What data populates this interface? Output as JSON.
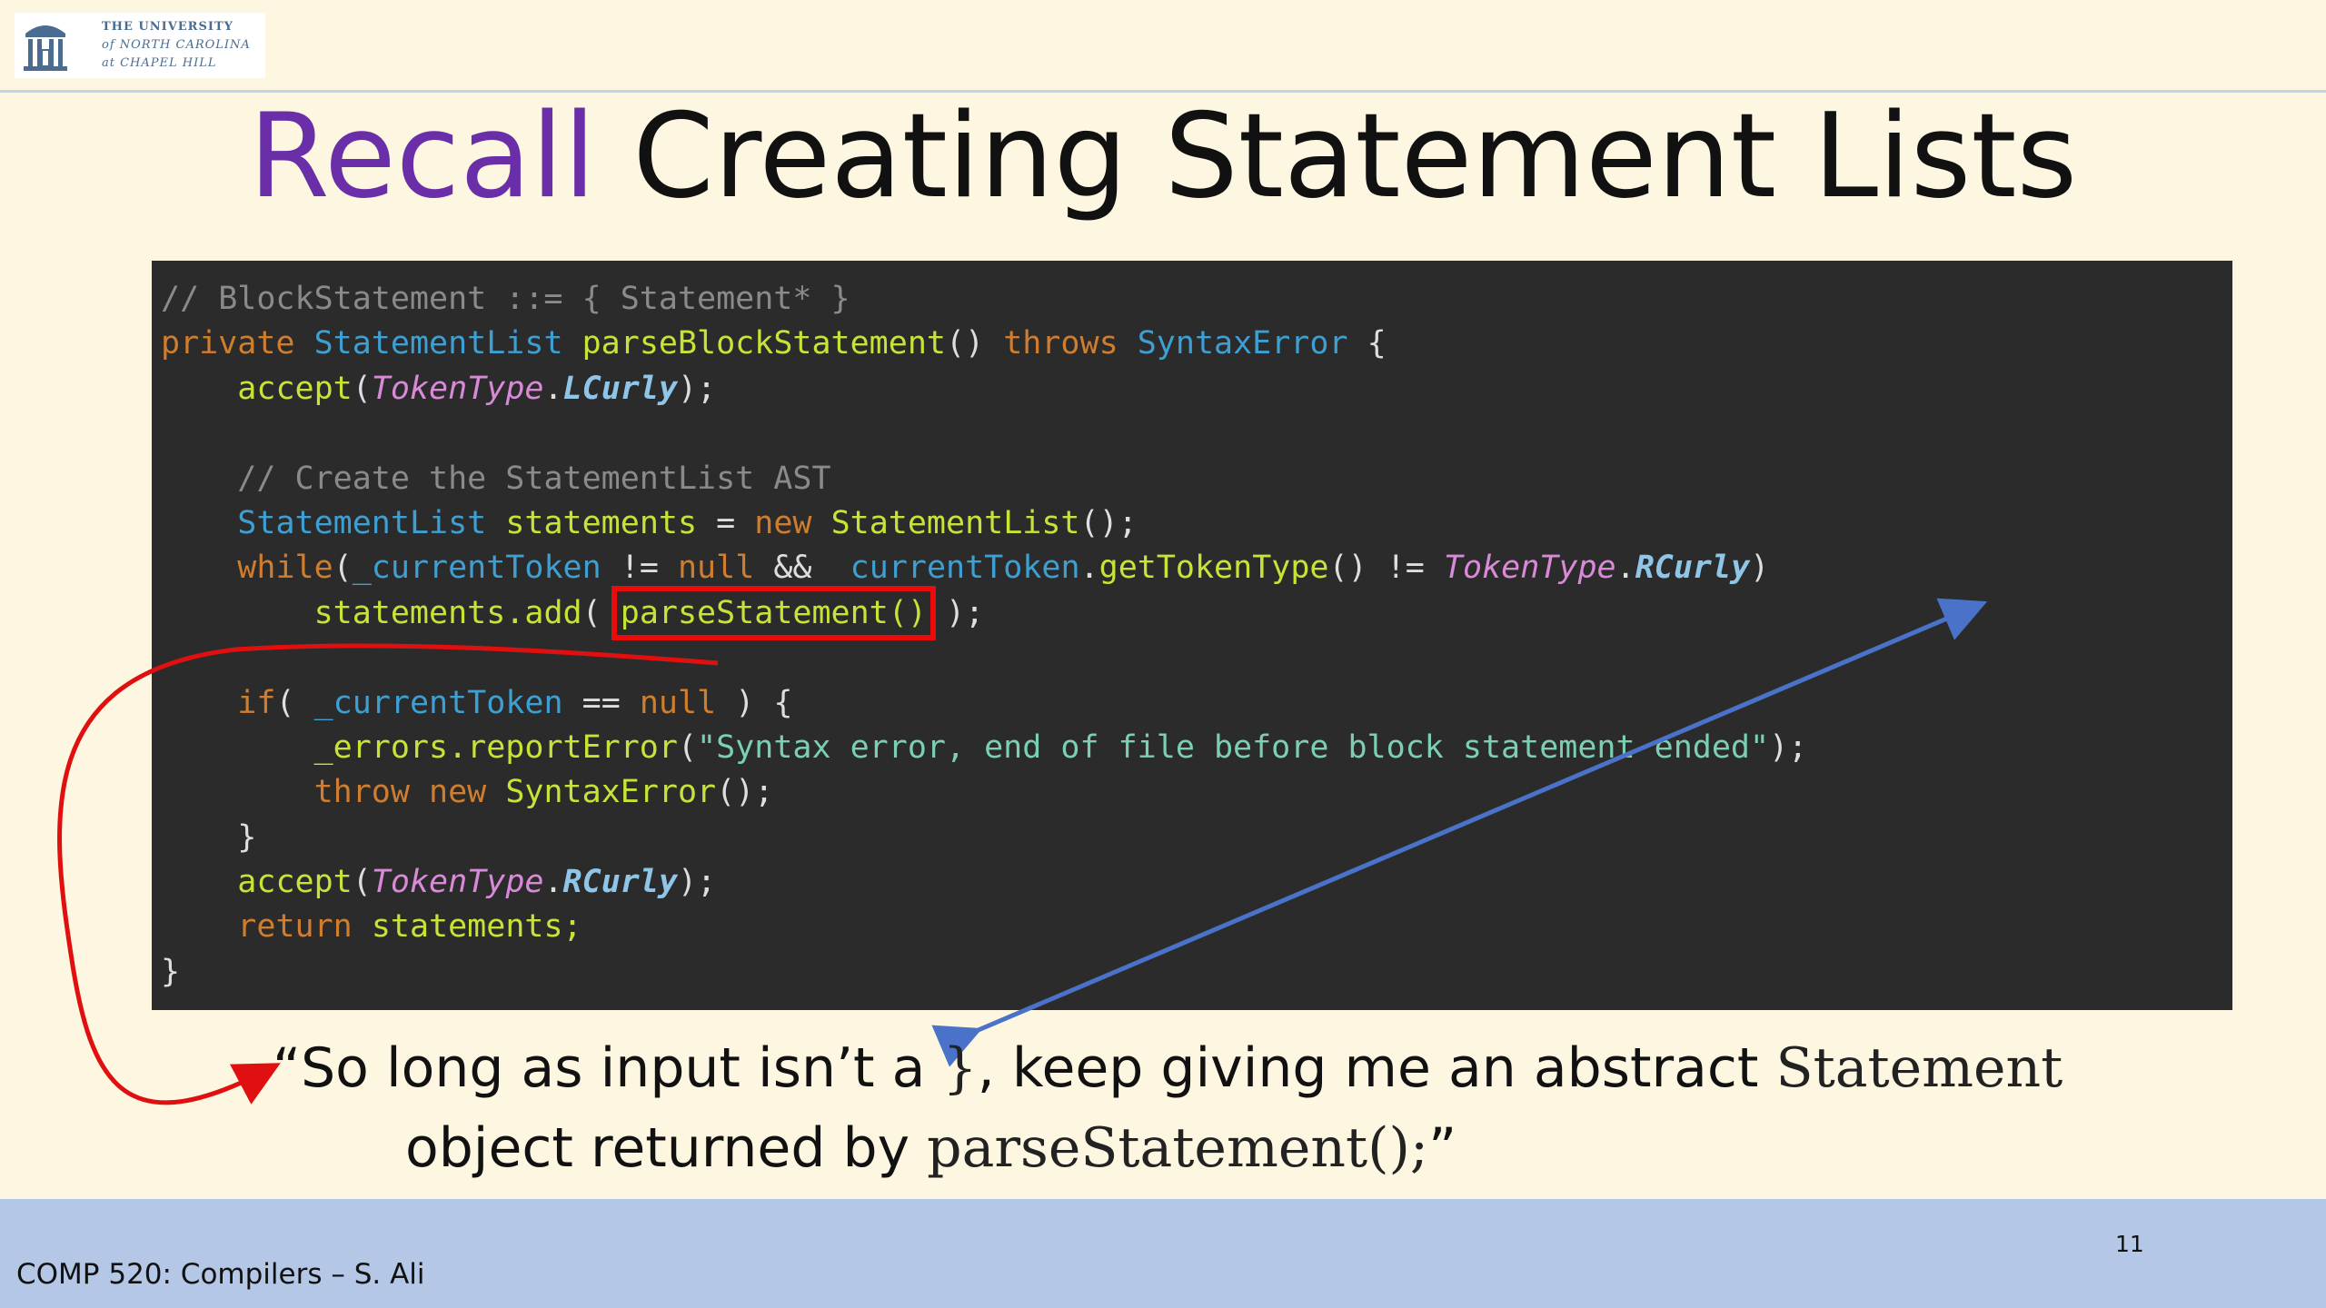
{
  "logo": {
    "line1": "THE UNIVERSITY",
    "line2": "of NORTH CAROLINA",
    "line3": "at CHAPEL HILL"
  },
  "title": {
    "accent": "Recall",
    "rest": "Creating Statement Lists"
  },
  "code": {
    "l1": "// BlockStatement ::= { Statement* }",
    "l2_kw1": "private",
    "l2_ty1": "StatementList",
    "l2_fn": "parseBlockStatement",
    "l2_parens": "()",
    "l2_kw2": "throws",
    "l2_ty2": "SyntaxError",
    "l2_brace": "{",
    "l3_fn": "accept",
    "l3_tt": "TokenType",
    "l3_tc": "LCurly",
    "l3_end": ");",
    "l5": "// Create the StatementList AST",
    "l6_ty": "StatementList",
    "l6_var": "statements",
    "l6_eq": "=",
    "l6_kw": "new",
    "l6_fn": "StatementList",
    "l6_end": "();",
    "l7_kw": "while",
    "l7_var": "_currentToken",
    "l7_ne": "!=",
    "l7_null": "null",
    "l7_and": "&&",
    "l7_ty": "currentToken",
    "l7_fn": "getTokenType",
    "l7_ne2": "!=",
    "l7_tt": "TokenType",
    "l7_tc": "RCurly",
    "l8_fn": "statements.add",
    "l8_call": "parseStatement()",
    "l8_end": ");",
    "l10_kw": "if",
    "l10_var": "_currentToken",
    "l10_eq": "==",
    "l10_null": "null",
    "l10_end": ") {",
    "l11_fn": "_errors.reportError",
    "l11_str": "\"Syntax error, end of file before block statement ended\"",
    "l11_end": ");",
    "l12_kw1": "throw",
    "l12_kw2": "new",
    "l12_fn": "SyntaxError",
    "l12_end": "();",
    "l13": "}",
    "l14_fn": "accept",
    "l14_tt": "TokenType",
    "l14_tc": "RCurly",
    "l14_end": ");",
    "l15_kw": "return",
    "l15_var": "statements;",
    "l16": "}"
  },
  "quote": {
    "open": "“So long as input isn’t a ",
    "brace": "}",
    "mid": ", keep giving me an abstract ",
    "statement": "Statement",
    "line2_pre": "object returned by ",
    "parse": "parseStatement();",
    "close": "”"
  },
  "footer": {
    "course": "COMP 520: Compilers – S. Ali",
    "page_number": "11"
  },
  "colors": {
    "background": "#fdf6e1",
    "title_accent": "#6a2fa8",
    "code_background": "#2b2b2b",
    "highlight_box": "#ea0b0b",
    "blue_arrow": "#4a72c8",
    "footer_band": "#b4c7e7"
  }
}
